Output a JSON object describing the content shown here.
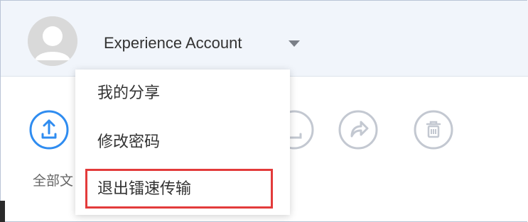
{
  "account": {
    "name": "Experience Account",
    "avatar_icon": "user-avatar-icon",
    "caret_icon": "caret-down-icon"
  },
  "toolbar": {
    "buttons": [
      {
        "icon": "upload-icon",
        "color": "#2f8cf0"
      },
      {
        "icon": "download-icon",
        "color": "#c3c8d1"
      },
      {
        "icon": "share-icon",
        "color": "#c3c8d1"
      },
      {
        "icon": "trash-icon",
        "color": "#c3c8d1"
      }
    ],
    "all_files_label": "全部文"
  },
  "dropdown": {
    "items": [
      {
        "label": "我的分享"
      },
      {
        "label": "修改密码"
      },
      {
        "label": "退出镭速传输",
        "highlighted": true
      }
    ],
    "highlight_color": "#e33b3b"
  }
}
